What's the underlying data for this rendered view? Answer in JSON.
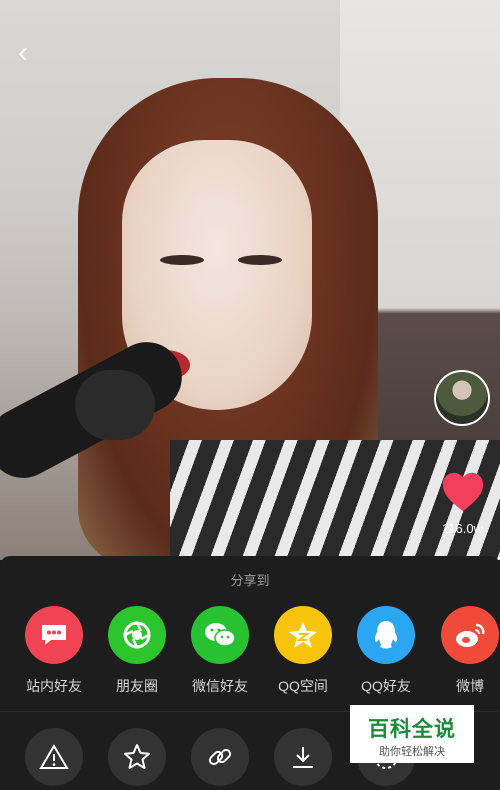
{
  "top": {
    "back_glyph": "‹"
  },
  "side": {
    "like_count": "116.0w"
  },
  "share_sheet": {
    "title": "分享到",
    "targets": [
      {
        "label": "站内好友",
        "color": "#f04455",
        "icon": "chat-bubble-icon"
      },
      {
        "label": "朋友圈",
        "color": "#2dc52d",
        "icon": "moments-aperture-icon"
      },
      {
        "label": "微信好友",
        "color": "#28c132",
        "icon": "wechat-icon"
      },
      {
        "label": "QQ空间",
        "color": "#f8c50c",
        "icon": "qzone-star-icon"
      },
      {
        "label": "QQ好友",
        "color": "#2aa6f2",
        "icon": "qq-penguin-icon"
      },
      {
        "label": "微博",
        "color": "#f04b3a",
        "icon": "weibo-icon"
      }
    ],
    "tools": [
      "report-warning-icon",
      "favorite-star-icon",
      "copy-link-icon",
      "download-icon",
      "more-icon"
    ]
  },
  "watermark": {
    "title": "百科全说",
    "subtitle": "助你轻松解决"
  }
}
